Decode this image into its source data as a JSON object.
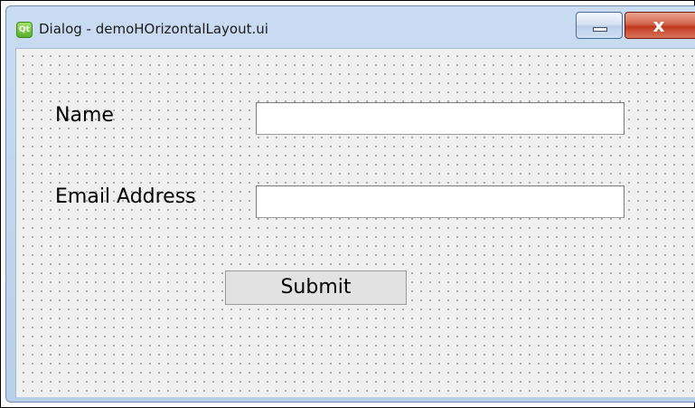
{
  "window": {
    "title": "Dialog - demoHOrizontalLayout.ui",
    "app_icon": "qt-icon",
    "app_icon_text": "Qt",
    "controls": {
      "minimize_icon": "minimize-icon",
      "close_icon": "close-icon",
      "close_glyph": "x"
    }
  },
  "form": {
    "name_label": "Name",
    "name_value": "",
    "email_label": "Email Address",
    "email_value": "",
    "submit_label": "Submit"
  },
  "colors": {
    "titlebar": "#c9dcf2",
    "close_button": "#c0391e",
    "client_background": "#f0f0f0",
    "grid_dots": "#9a9a9a"
  }
}
